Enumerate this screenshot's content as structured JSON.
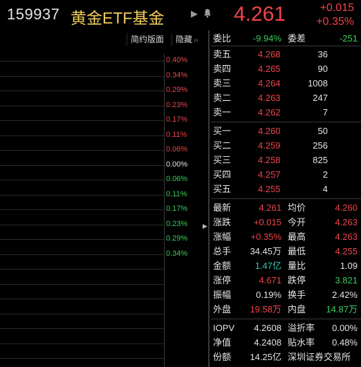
{
  "header": {
    "code": "159937",
    "name": "黄金ETF基金",
    "price": "4.261",
    "change": "+0.015",
    "change_pct": "+0.35%",
    "play_icon": "play-icon",
    "bell_icon": "bell-icon"
  },
  "toolbar": {
    "simple_label": "简约版面",
    "hide_label": "隐藏",
    "hide_arrow": "››"
  },
  "chart": {
    "pct_labels": [
      {
        "text": "0.40%",
        "color": "red"
      },
      {
        "text": "0.34%",
        "color": "red"
      },
      {
        "text": "0.29%",
        "color": "red"
      },
      {
        "text": "0.23%",
        "color": "red"
      },
      {
        "text": "0.17%",
        "color": "red"
      },
      {
        "text": "0.11%",
        "color": "red"
      },
      {
        "text": "0.06%",
        "color": "red"
      },
      {
        "text": "0.00%",
        "color": "white"
      },
      {
        "text": "0.06%",
        "color": "green"
      },
      {
        "text": "0.11%",
        "color": "green"
      },
      {
        "text": "0.17%",
        "color": "green"
      },
      {
        "text": "0.23%",
        "color": "green"
      },
      {
        "text": "0.29%",
        "color": "green"
      },
      {
        "text": "0.34%",
        "color": "green"
      }
    ],
    "expand_arrow": "▶"
  },
  "panel": {
    "ratio": {
      "l1": "委比",
      "v1": "-9.94%",
      "l2": "委差",
      "v2": "-251"
    },
    "asks": [
      {
        "label": "卖五",
        "price": "4.268",
        "vol": "36"
      },
      {
        "label": "卖四",
        "price": "4.265",
        "vol": "90"
      },
      {
        "label": "卖三",
        "price": "4.264",
        "vol": "1008"
      },
      {
        "label": "卖二",
        "price": "4.263",
        "vol": "247"
      },
      {
        "label": "卖一",
        "price": "4.262",
        "vol": "7"
      }
    ],
    "bids": [
      {
        "label": "买一",
        "price": "4.260",
        "vol": "50"
      },
      {
        "label": "买二",
        "price": "4.259",
        "vol": "256"
      },
      {
        "label": "买三",
        "price": "4.258",
        "vol": "825"
      },
      {
        "label": "买四",
        "price": "4.257",
        "vol": "2"
      },
      {
        "label": "买五",
        "price": "4.255",
        "vol": "4"
      }
    ],
    "stats": [
      {
        "l1": "最新",
        "v1": "4.261",
        "c1": "red",
        "l2": "均价",
        "v2": "4.260",
        "c2": "red"
      },
      {
        "l1": "涨跌",
        "v1": "+0.015",
        "c1": "red",
        "l2": "今开",
        "v2": "4.263",
        "c2": "red"
      },
      {
        "l1": "涨幅",
        "v1": "+0.35%",
        "c1": "red",
        "l2": "最高",
        "v2": "4.263",
        "c2": "red"
      },
      {
        "l1": "总手",
        "v1": "34.45万",
        "c1": "white",
        "l2": "最低",
        "v2": "4.255",
        "c2": "red"
      },
      {
        "l1": "金额",
        "v1": "1.47亿",
        "c1": "cyan",
        "l2": "量比",
        "v2": "1.09",
        "c2": "white"
      },
      {
        "l1": "涨停",
        "v1": "4.671",
        "c1": "red",
        "l2": "跌停",
        "v2": "3.821",
        "c2": "green"
      },
      {
        "l1": "振幅",
        "v1": "0.19%",
        "c1": "white",
        "l2": "换手",
        "v2": "2.42%",
        "c2": "white"
      },
      {
        "l1": "外盘",
        "v1": "19.58万",
        "c1": "red",
        "l2": "内盘",
        "v2": "14.87万",
        "c2": "green"
      }
    ],
    "fund": [
      {
        "l1": "IOPV",
        "v1": "4.2608",
        "l2": "溢折率",
        "v2": "0.00%"
      },
      {
        "l1": "净值",
        "v1": "4.2408",
        "l2": "贴水率",
        "v2": "0.48%"
      },
      {
        "l1": "份额",
        "v1": "14.25亿",
        "l2": "深圳证券交易所",
        "v2": ""
      }
    ]
  },
  "colors": {
    "red": "#f0444a",
    "green": "#3ad05a",
    "gold": "#f2cc5a",
    "cyan": "#38c8b8"
  }
}
